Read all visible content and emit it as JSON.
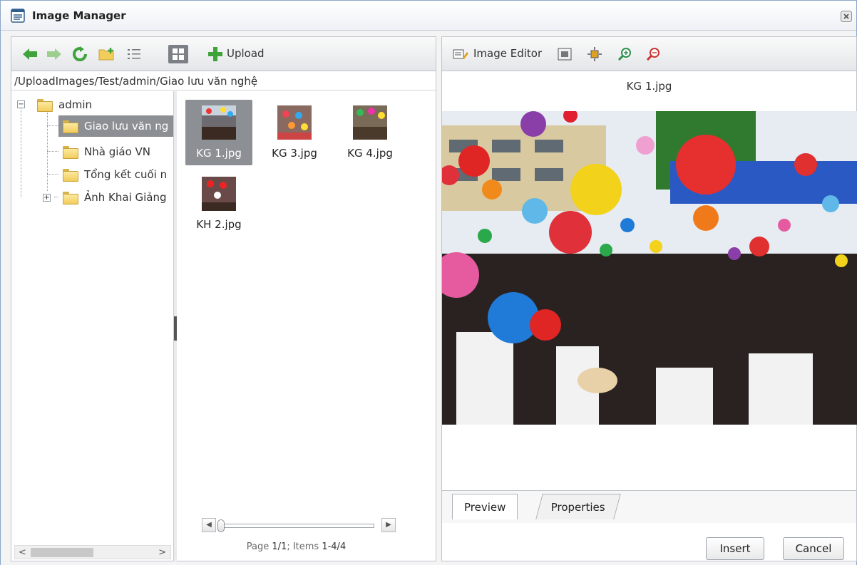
{
  "window": {
    "title": "Image Manager"
  },
  "toolbar": {
    "upload_label": "Upload"
  },
  "path": "/UploadImages/Test/admin/Giao lưu văn nghệ",
  "tree": {
    "root": "admin",
    "children": [
      "Giao lưu văn ng",
      "Nhà giáo VN",
      "Tổng kết cuối n",
      "Ảnh Khai Giảng"
    ]
  },
  "files": [
    {
      "name": "KG 1.jpg"
    },
    {
      "name": "KG 3.jpg"
    },
    {
      "name": "KG 4.jpg"
    },
    {
      "name": "KH 2.jpg"
    }
  ],
  "pager": {
    "prefix": "Page ",
    "page": "1/1",
    "sep": "; Items ",
    "items": "1-4/4"
  },
  "preview": {
    "editor_label": "Image Editor",
    "file_name": "KG 1.jpg"
  },
  "tabs": {
    "preview": "Preview",
    "properties": "Properties"
  },
  "buttons": {
    "insert": "Insert",
    "cancel": "Cancel"
  },
  "colors": {
    "selection": "#8c8f93",
    "border": "#bfc4cb",
    "green_arrow": "#3fa33b"
  }
}
